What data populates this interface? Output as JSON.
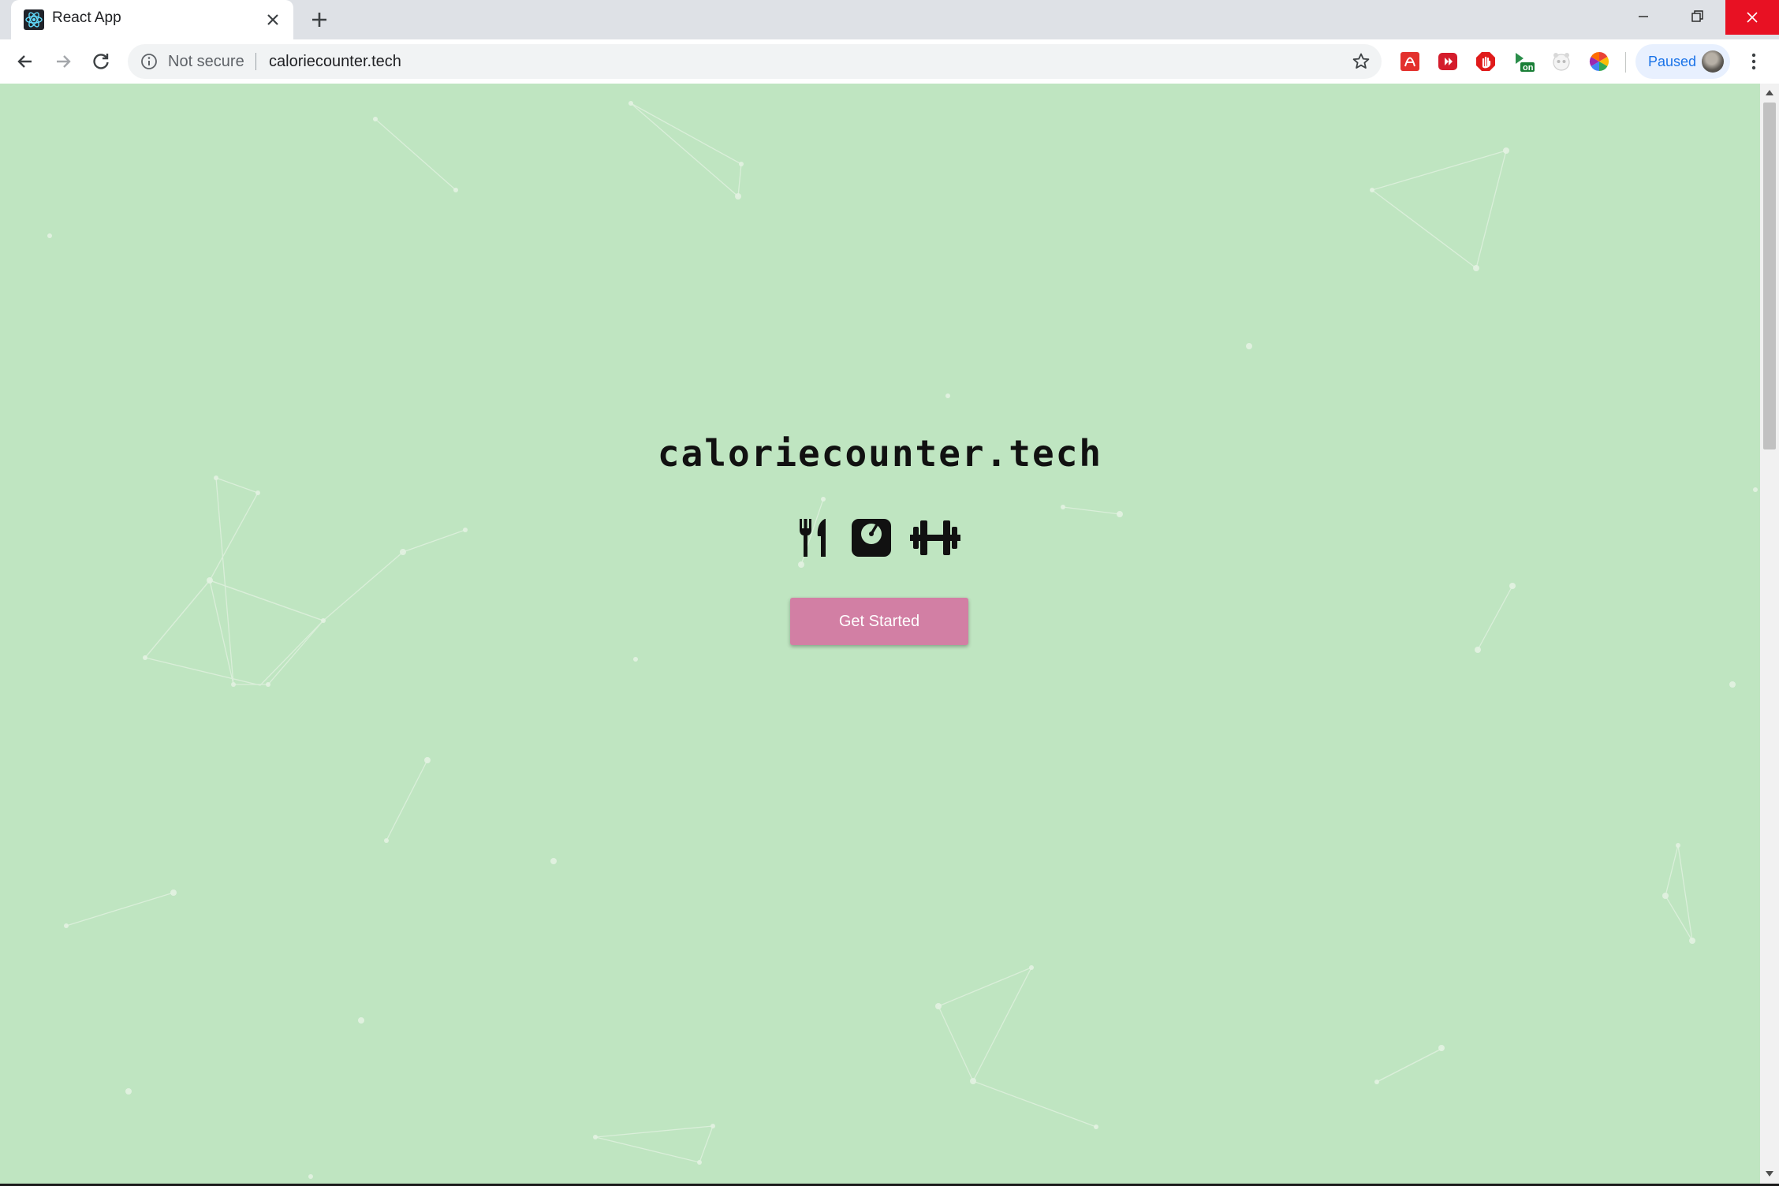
{
  "browser": {
    "tab": {
      "title": "React App",
      "favicon": "react-logo-icon"
    },
    "address_bar": {
      "security_label": "Not secure",
      "url": "caloriecounter.tech"
    },
    "extensions": [
      "pdf-extension-icon",
      "media-extension-icon",
      "adblock-extension-icon",
      "on-toggle-extension-icon",
      "panda-extension-icon",
      "color-wheel-extension-icon"
    ],
    "extension_badge": "on",
    "profile": {
      "status": "Paused"
    }
  },
  "page": {
    "title": "caloriecounter.tech",
    "icons": [
      "utensils-icon",
      "weight-scale-icon",
      "dumbbell-icon"
    ],
    "cta_label": "Get Started"
  },
  "colors": {
    "background": "#bfe5c1",
    "button": "#d27fa4",
    "title_text": "#111111",
    "window_close": "#e81123"
  }
}
